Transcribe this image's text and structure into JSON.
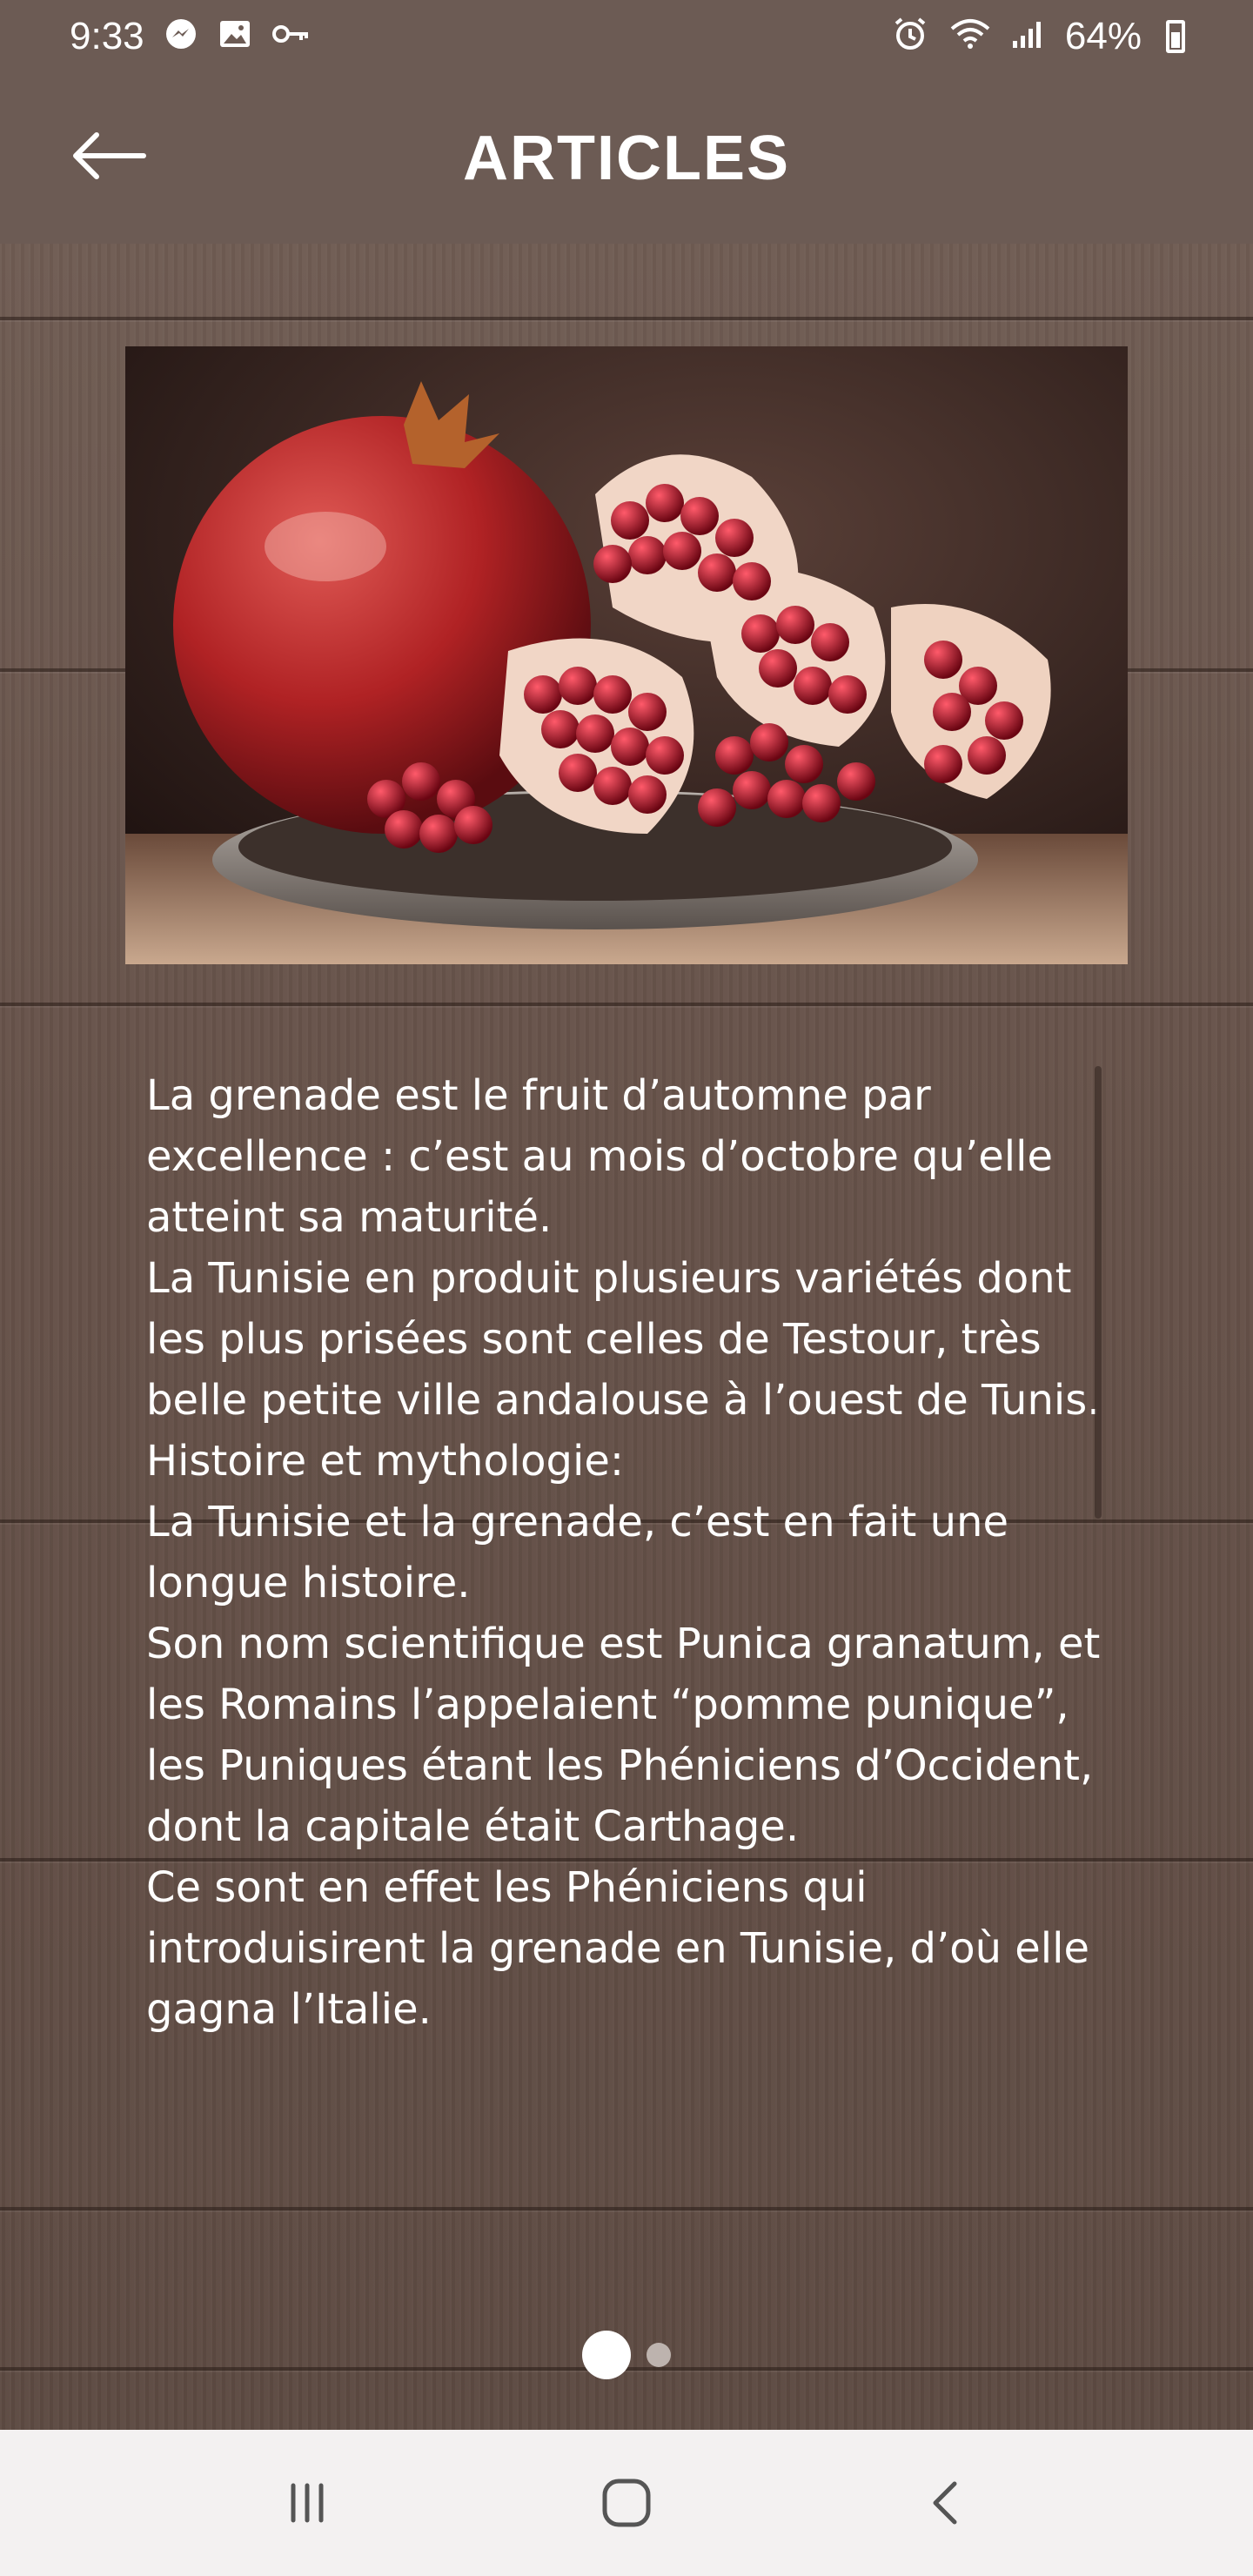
{
  "status_bar": {
    "time": "9:33",
    "battery": "64%",
    "left_icons": [
      "messenger-icon",
      "gallery-icon",
      "key-icon"
    ],
    "right_icons": [
      "alarm-icon",
      "wifi-icon",
      "signal-icon",
      "battery-icon"
    ]
  },
  "app_bar": {
    "title": "ARTICLES"
  },
  "article": {
    "image": "pomegranate-photo",
    "paragraphs": [
      "La grenade est le fruit d’automne par excellence : c’est au mois d’octobre qu’elle atteint sa maturité.",
      "La Tunisie en produit plusieurs variétés dont les plus prisées sont celles de Testour, très belle petite ville andalouse à l’ouest de Tunis.",
      "Histoire et mythologie:",
      "La Tunisie et la grenade, c’est en fait une longue histoire.",
      "Son nom scientifique est Punica granatum, et les Romains l’appelaient “pomme punique”, les Puniques étant les Phéniciens d’Occident, dont la capitale était Carthage.",
      "Ce sont en effet les Phéniciens qui introduisirent la grenade en Tunisie, d’où elle gagna l’Italie."
    ]
  },
  "pager": {
    "total": 2,
    "current": 1
  },
  "colors": {
    "app_bar": "#6c5b54",
    "wood": "#665249",
    "nav_bar": "#f3f1f1"
  }
}
